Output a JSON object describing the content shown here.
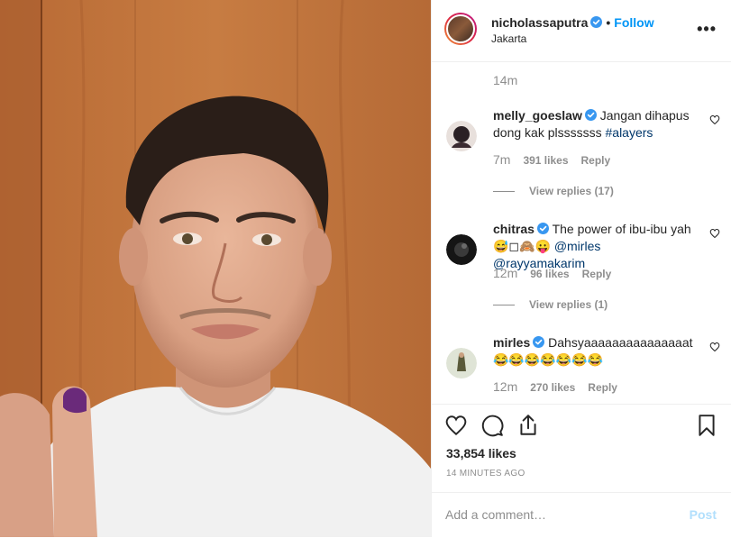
{
  "post": {
    "username": "nicholassaputra",
    "location": "Jakarta",
    "follow_label": "Follow",
    "separator": "•",
    "more_label": "•••",
    "top_timestamp": "14m"
  },
  "comments": [
    {
      "username": "melly_goeslaw",
      "text": "Jangan dihapus dong kak plsssssss ",
      "tag": "#alayers",
      "time": "7m",
      "likes": "391 likes",
      "reply_label": "Reply",
      "view_replies": "View replies (17)"
    },
    {
      "username": "chitras",
      "text": "The power of ibu-ibu yah 😅◻🙈😛 ",
      "tag": "@mirles @rayyamakarim",
      "time": "12m",
      "likes": "96 likes",
      "reply_label": "Reply",
      "view_replies": "View replies (1)"
    },
    {
      "username": "mirles",
      "text": "Dahsyaaaaaaaaaaaaaaat 😂😂😂😂😂😂😂",
      "tag": "",
      "time": "12m",
      "likes": "270 likes",
      "reply_label": "Reply",
      "view_replies": ""
    }
  ],
  "likes_count": "33,854 likes",
  "time_ago": "14 MINUTES AGO",
  "add_comment": {
    "placeholder": "Add a comment…",
    "post_label": "Post"
  },
  "icons": {
    "heart": "heart-icon",
    "comment": "comment-icon",
    "share": "share-icon",
    "bookmark": "bookmark-icon",
    "verified": "verified-badge-icon",
    "more": "more-options-icon"
  },
  "colors": {
    "follow": "#0095f6",
    "verified": "#3897f0",
    "muted": "#8e8e8e",
    "post_disabled": "#b2dffc"
  }
}
